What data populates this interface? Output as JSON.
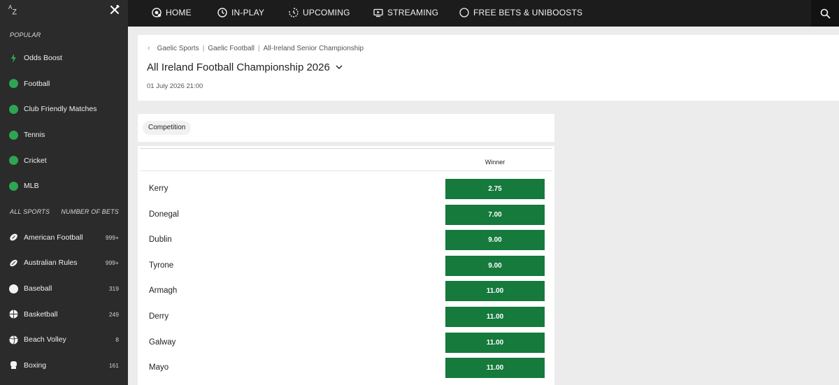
{
  "sidebar": {
    "az_label": "A",
    "az_sub": "Z",
    "popular_label": "POPULAR",
    "popular": [
      {
        "label": "Odds Boost",
        "icon": "odds-boost-icon"
      },
      {
        "label": "Football",
        "icon": "football-icon"
      },
      {
        "label": "Club Friendly Matches",
        "icon": "football-icon"
      },
      {
        "label": "Tennis",
        "icon": "tennis-icon"
      },
      {
        "label": "Cricket",
        "icon": "cricket-icon"
      },
      {
        "label": "MLB",
        "icon": "mlb-icon"
      }
    ],
    "all_sports_label": "ALL SPORTS",
    "number_of_bets_label": "NUMBER OF BETS",
    "sports": [
      {
        "label": "American Football",
        "count": "999+",
        "icon": "american-football-icon"
      },
      {
        "label": "Australian Rules",
        "count": "999+",
        "icon": "australian-rules-icon"
      },
      {
        "label": "Baseball",
        "count": "319",
        "icon": "baseball-icon"
      },
      {
        "label": "Basketball",
        "count": "249",
        "icon": "basketball-icon"
      },
      {
        "label": "Beach Volley",
        "count": "8",
        "icon": "volleyball-icon"
      },
      {
        "label": "Boxing",
        "count": "161",
        "icon": "boxing-icon"
      }
    ]
  },
  "nav": {
    "items": [
      {
        "label": "HOME",
        "icon": "home-icon"
      },
      {
        "label": "IN-PLAY",
        "icon": "clock-icon"
      },
      {
        "label": "UPCOMING",
        "icon": "upcoming-icon"
      },
      {
        "label": "STREAMING",
        "icon": "streaming-icon"
      },
      {
        "label": "FREE BETS & UNIBOOSTS",
        "icon": "free-bets-icon"
      }
    ]
  },
  "breadcrumb": [
    "Gaelic Sports",
    "Gaelic Football",
    "All-Ireland Senior Championship"
  ],
  "event": {
    "title": "All Ireland Football Championship 2026",
    "date": "01 July 2026 21:00"
  },
  "competition_tab": "Competition",
  "market": {
    "column_header": "Winner",
    "rows": [
      {
        "team": "Kerry",
        "odds": "2.75"
      },
      {
        "team": "Donegal",
        "odds": "7.00"
      },
      {
        "team": "Dublin",
        "odds": "9.00"
      },
      {
        "team": "Tyrone",
        "odds": "9.00"
      },
      {
        "team": "Armagh",
        "odds": "11.00"
      },
      {
        "team": "Derry",
        "odds": "11.00"
      },
      {
        "team": "Galway",
        "odds": "11.00"
      },
      {
        "team": "Mayo",
        "odds": "11.00"
      }
    ]
  },
  "colors": {
    "odds_green": "#157a3c",
    "sidebar_bg": "#2b2b2b",
    "nav_bg": "#1c1c1c",
    "accent_green": "#2ea552"
  }
}
